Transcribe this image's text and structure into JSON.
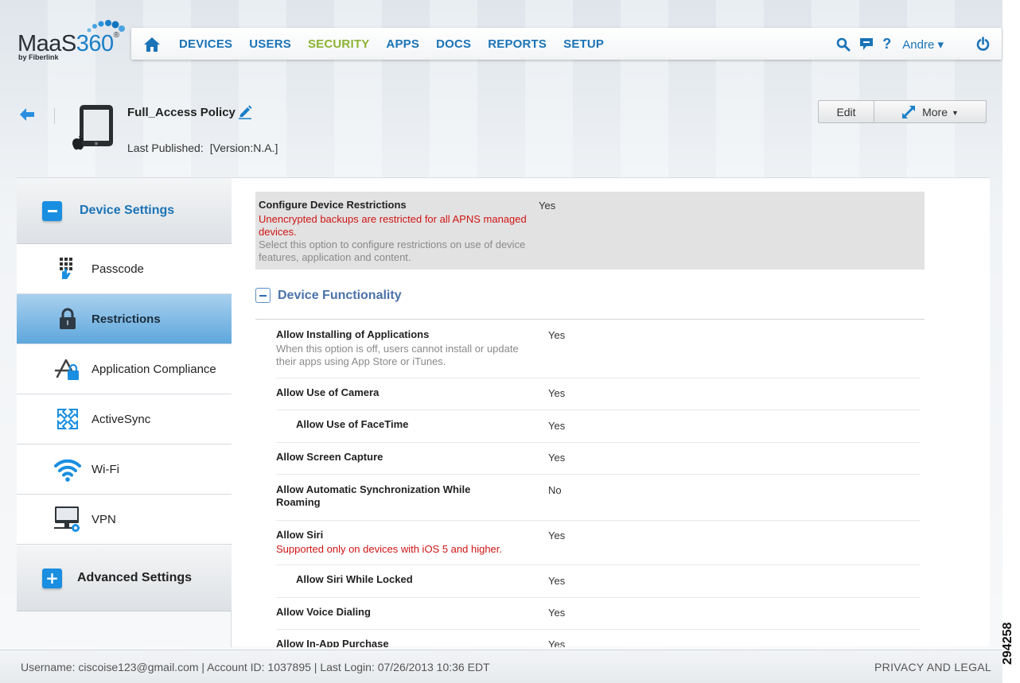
{
  "brand": {
    "name_prefix": "MaaS",
    "name_suffix": "360",
    "reg_mark": "®",
    "tagline": "by Fiberlink"
  },
  "nav": {
    "items": [
      {
        "label": "DEVICES"
      },
      {
        "label": "USERS"
      },
      {
        "label": "SECURITY"
      },
      {
        "label": "APPS"
      },
      {
        "label": "DOCS"
      },
      {
        "label": "REPORTS"
      },
      {
        "label": "SETUP"
      }
    ],
    "active": "SECURITY",
    "user_label": "Andre ▾",
    "icons": [
      "home-icon",
      "search-icon",
      "chat-icon",
      "help-icon",
      "power-icon"
    ]
  },
  "header": {
    "policy_name": "Full_Access Policy",
    "published_label": "Last Published:",
    "published_value": "[Version:N.A.]",
    "edit_label": "Edit",
    "more_label": "More"
  },
  "sidebar": {
    "device_settings": "Device Settings",
    "advanced_settings": "Advanced Settings",
    "items": [
      {
        "label": "Passcode",
        "icon": "keypad-icon"
      },
      {
        "label": "Restrictions",
        "icon": "lock-icon"
      },
      {
        "label": "Application Compliance",
        "icon": "app-lock-icon"
      },
      {
        "label": "ActiveSync",
        "icon": "sync-icon"
      },
      {
        "label": "Wi-Fi",
        "icon": "wifi-icon"
      },
      {
        "label": "VPN",
        "icon": "vpn-icon"
      }
    ]
  },
  "content": {
    "configure": {
      "title": "Configure Device Restrictions",
      "warning": "Unencrypted backups are restricted for all APNS managed devices.",
      "description": "Select this option to configure restrictions on use of device features, application and content.",
      "value": "Yes"
    },
    "group_title": "Device Functionality",
    "rows": [
      {
        "title": "Allow Installing of Applications",
        "sub": "When this option is off, users cannot install or update their apps using App Store or iTunes.",
        "value": "Yes"
      },
      {
        "title": "Allow Use of Camera",
        "value": "Yes"
      },
      {
        "title": "Allow Use of FaceTime",
        "value": "Yes"
      },
      {
        "title": "Allow Screen Capture",
        "value": "Yes"
      },
      {
        "title": "Allow Automatic Synchronization While Roaming",
        "value": "No"
      },
      {
        "title": "Allow Siri",
        "note": "Supported only on devices with iOS 5 and higher.",
        "value": "Yes"
      },
      {
        "title": "Allow Siri While Locked",
        "value": "Yes"
      },
      {
        "title": "Allow Voice Dialing",
        "value": "Yes"
      },
      {
        "title": "Allow In-App Purchase",
        "value": "Yes"
      }
    ]
  },
  "footer": {
    "info": "Username:  ciscoise123@gmail.com  | Account ID:  1037895  | Last Login: 07/26/2013 10:36 EDT",
    "privacy": "PRIVACY AND LEGAL"
  },
  "figure_number": "294258",
  "colors": {
    "nav_link": "#1a73b6",
    "nav_active": "#8cb332",
    "accent": "#1a8ee0",
    "warning": "#d01414"
  }
}
